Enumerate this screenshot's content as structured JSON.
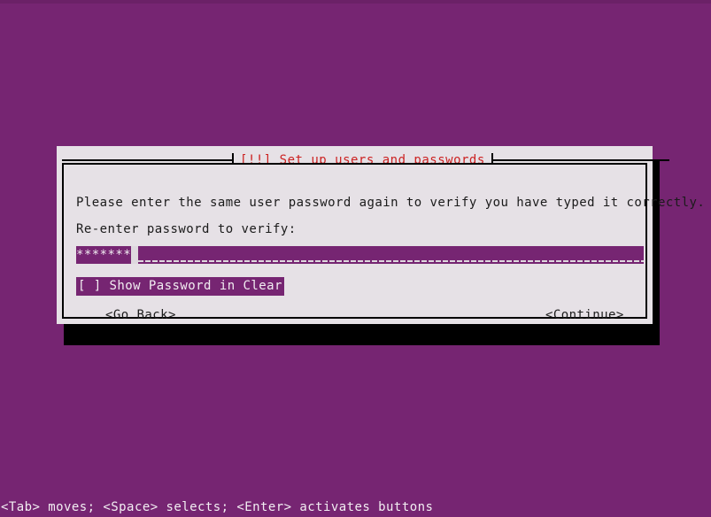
{
  "screen": {
    "background_color": "#762572",
    "foreground_color": "#f2eef2"
  },
  "dialog": {
    "title": "[!!] Set up users and passwords",
    "title_color": "#cc2222",
    "background_color": "#e6e1e6",
    "text_color": "#1b1b1b",
    "prompt": "Please enter the same user password again to verify you have typed it correctly.",
    "field_label": "Re-enter password to verify:",
    "password_input": {
      "masked_value": "*******",
      "mask_character": "*",
      "character_count": 7,
      "highlight_color": "#762572",
      "cursor_color": "#ded8de"
    },
    "checkbox": {
      "label": "[ ] Show Password in Clear",
      "checked": false,
      "focused": true,
      "highlight_color": "#762572"
    },
    "buttons": [
      {
        "label": "<Go Back>",
        "focused": false
      },
      {
        "label": "<Continue>",
        "focused": false
      }
    ]
  },
  "status_bar": {
    "text": "<Tab> moves; <Space> selects; <Enter> activates buttons"
  }
}
